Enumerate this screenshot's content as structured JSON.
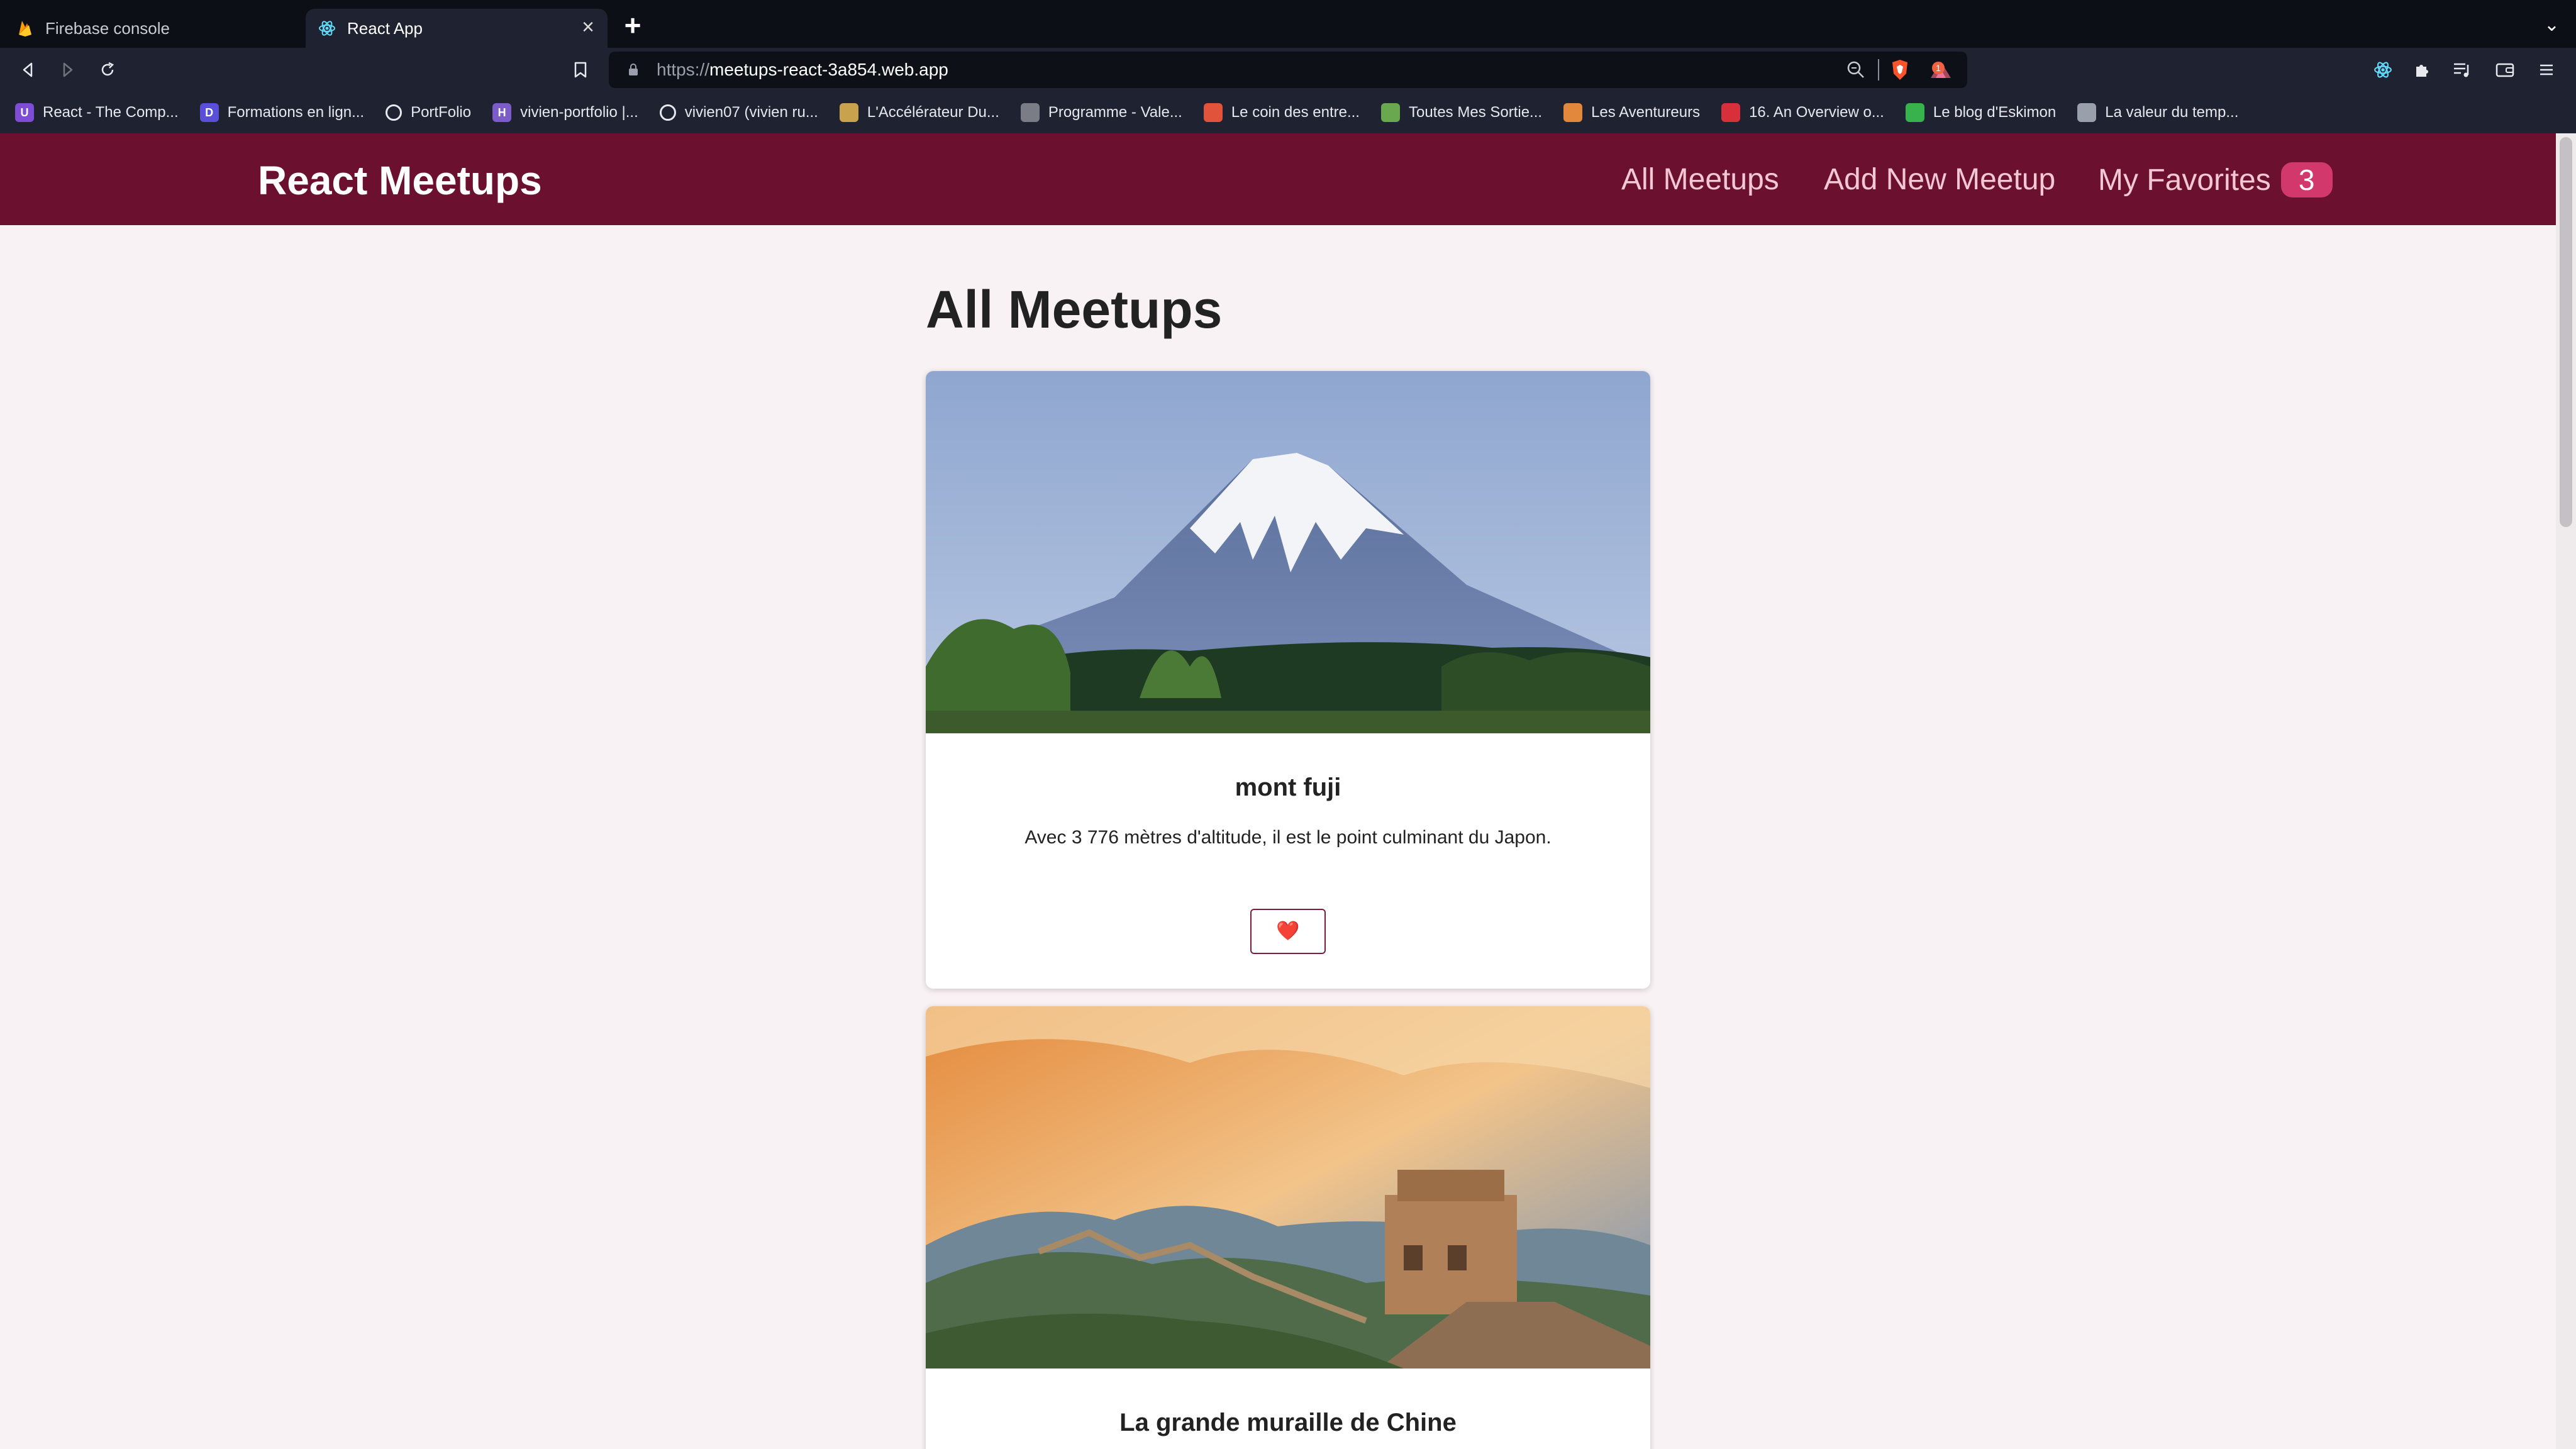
{
  "browser": {
    "tabs": [
      {
        "title": "Firebase console",
        "icon": "firebase-icon"
      },
      {
        "title": "React App",
        "icon": "react-icon",
        "active": true
      }
    ],
    "url_scheme": "https://",
    "url_host": "meetups-react-3a854.web.app",
    "rewards_count": "1",
    "bookmarks": [
      {
        "label": "React - The Comp...",
        "icon_letter": "U",
        "color": "#7d4dd6"
      },
      {
        "label": "Formations en lign...",
        "icon_letter": "D",
        "color": "#5a4fd9"
      },
      {
        "label": "PortFolio",
        "icon_letter": "",
        "color": "#e6e8ee"
      },
      {
        "label": "vivien-portfolio |...",
        "icon_letter": "H",
        "color": "#7b5cc8"
      },
      {
        "label": "vivien07 (vivien ru...",
        "icon_letter": "",
        "color": "#e6e8ee"
      },
      {
        "label": "L'Accélérateur Du...",
        "icon_letter": "",
        "color": "#c9a24e"
      },
      {
        "label": "Programme - Vale...",
        "icon_letter": "",
        "color": "#7a7d86"
      },
      {
        "label": "Le coin des entre...",
        "icon_letter": "",
        "color": "#e2533c"
      },
      {
        "label": "Toutes Mes Sortie...",
        "icon_letter": "",
        "color": "#6aa84f"
      },
      {
        "label": "Les Aventureurs",
        "icon_letter": "",
        "color": "#e2883c"
      },
      {
        "label": "16. An Overview o...",
        "icon_letter": "",
        "color": "#d8303a"
      },
      {
        "label": "Le blog d'Eskimon",
        "icon_letter": "",
        "color": "#37b24d"
      },
      {
        "label": "La valeur du temp...",
        "icon_letter": "",
        "color": "#9aa0ab"
      }
    ]
  },
  "app": {
    "logo": "React Meetups",
    "nav": {
      "all": "All Meetups",
      "add": "Add New Meetup",
      "favorites": "My Favorites",
      "favorites_count": "3"
    },
    "page_title": "All Meetups",
    "meetups": [
      {
        "title": "mont fuji",
        "description": "Avec 3 776 mètres d'altitude, il est le point culminant du Japon.",
        "fav_icon": "❤️"
      },
      {
        "title": "La grande muraille de Chine"
      }
    ]
  },
  "colors": {
    "header": "#6b102e",
    "badge": "#d2386b",
    "page_bg": "#f9f2f4"
  }
}
